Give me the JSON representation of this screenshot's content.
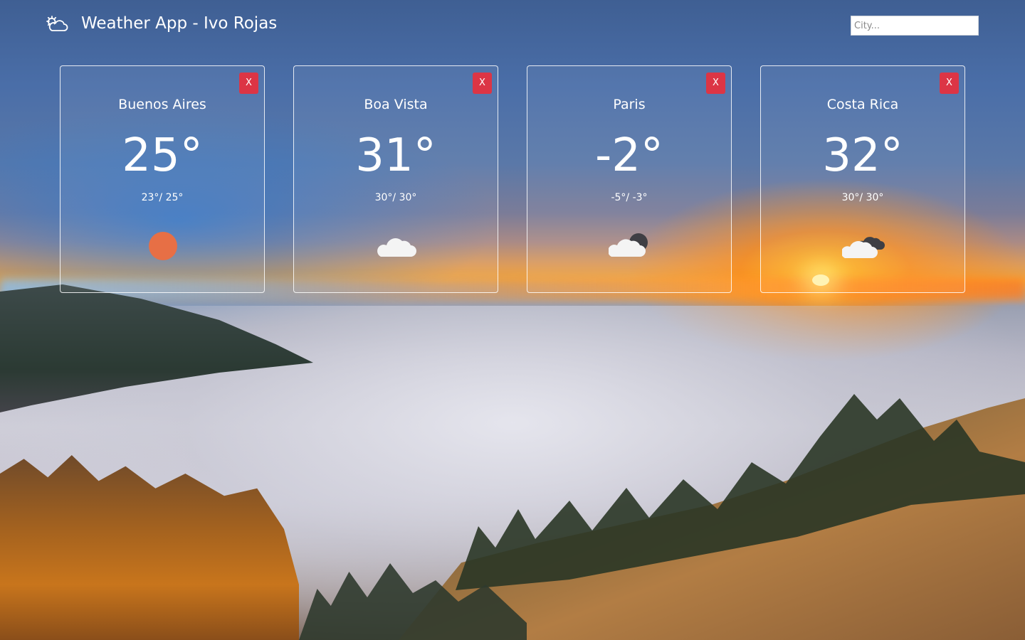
{
  "header": {
    "title": "Weather App - Ivo Rojas",
    "logo_icon": "partly-cloudy-icon",
    "search": {
      "placeholder": "City...",
      "value": ""
    }
  },
  "cards": [
    {
      "city": "Buenos Aires",
      "temp": "25°",
      "minmax": "23°/ 25°",
      "icon": "sun-icon",
      "close_label": "X"
    },
    {
      "city": "Boa Vista",
      "temp": "31°",
      "minmax": "30°/ 30°",
      "icon": "cloud-icon",
      "close_label": "X"
    },
    {
      "city": "Paris",
      "temp": "-2°",
      "minmax": "-5°/ -3°",
      "icon": "cloudy-night-icon",
      "close_label": "X"
    },
    {
      "city": "Costa Rica",
      "temp": "32°",
      "minmax": "30°/ 30°",
      "icon": "overcast-clouds-icon",
      "close_label": "X"
    }
  ],
  "colors": {
    "close_button": "#dc3545",
    "sun": "#e76f45",
    "cloud_light": "#f4f4f4",
    "cloud_dark": "#3f3f44"
  }
}
